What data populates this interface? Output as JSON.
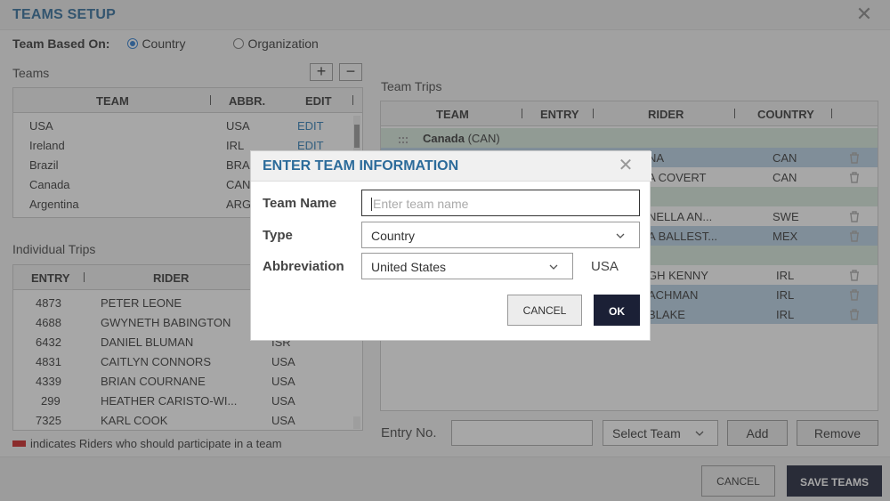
{
  "window": {
    "title": "TEAMS SETUP",
    "close_icon": "close-icon"
  },
  "based_on": {
    "label": "Team Based On:",
    "options": [
      "Country",
      "Organization"
    ],
    "selected": "Country"
  },
  "teams": {
    "label": "Teams",
    "add_icon": "plus-icon",
    "remove_icon": "minus-icon",
    "columns": [
      "TEAM",
      "ABBR.",
      "EDIT"
    ],
    "rows": [
      {
        "team": "USA",
        "abbr": "USA",
        "edit": "EDIT"
      },
      {
        "team": "Ireland",
        "abbr": "IRL",
        "edit": "EDIT"
      },
      {
        "team": "Brazil",
        "abbr": "BRA",
        "edit": ""
      },
      {
        "team": "Canada",
        "abbr": "CAN",
        "edit": ""
      },
      {
        "team": "Argentina",
        "abbr": "ARG",
        "edit": ""
      }
    ]
  },
  "individual": {
    "label": "Individual Trips",
    "columns": [
      "ENTRY",
      "RIDER"
    ],
    "rows": [
      {
        "entry": "4873",
        "rider": "PETER LEONE",
        "country": ""
      },
      {
        "entry": "4688",
        "rider": "GWYNETH BABINGTON",
        "country": ""
      },
      {
        "entry": "6432",
        "rider": "DANIEL BLUMAN",
        "country": "ISR"
      },
      {
        "entry": "4831",
        "rider": "CAITLYN CONNORS",
        "country": "USA"
      },
      {
        "entry": "4339",
        "rider": "BRIAN COURNANE",
        "country": "USA"
      },
      {
        "entry": "299",
        "rider": "HEATHER CARISTO-WI...",
        "country": "USA"
      },
      {
        "entry": "7325",
        "rider": "KARL COOK",
        "country": "USA"
      }
    ],
    "legend": "indicates Riders who should participate in a team",
    "legend_color": "#cc1f1f"
  },
  "team_trips": {
    "label": "Team Trips",
    "columns": [
      "TEAM",
      "ENTRY",
      "RIDER",
      "COUNTRY"
    ],
    "rows": [
      {
        "kind": "group",
        "team": "Canada",
        "abbr": "(CAN)",
        "rider": "",
        "country": ""
      },
      {
        "kind": "sel",
        "team": "",
        "abbr": "",
        "rider": "NA",
        "country": "CAN"
      },
      {
        "kind": "plain",
        "team": "",
        "abbr": "",
        "rider": "A COVERT",
        "country": "CAN"
      },
      {
        "kind": "group",
        "team": "",
        "abbr": "",
        "rider": "",
        "country": ""
      },
      {
        "kind": "plain",
        "team": "",
        "abbr": "",
        "rider": "NELLA AN...",
        "country": "SWE"
      },
      {
        "kind": "sel",
        "team": "",
        "abbr": "",
        "rider": "A BALLEST...",
        "country": "MEX"
      },
      {
        "kind": "group",
        "team": "",
        "abbr": "",
        "rider": "",
        "country": ""
      },
      {
        "kind": "plain",
        "team": "",
        "abbr": "",
        "rider": "GH KENNY",
        "country": "IRL"
      },
      {
        "kind": "sel",
        "team": "",
        "abbr": "",
        "rider": "ACHMAN",
        "country": "IRL"
      },
      {
        "kind": "sel",
        "team": "",
        "abbr": "",
        "rider": "BLAKE",
        "country": "IRL"
      }
    ],
    "group_color": "#d7e9dc",
    "selected_color": "#b8d1e6"
  },
  "entry_bar": {
    "entry_label": "Entry No.",
    "entry_value": "",
    "select_team": "Select Team",
    "add": "Add",
    "remove": "Remove"
  },
  "footer": {
    "cancel": "CANCEL",
    "save": "SAVE TEAMS"
  },
  "dialog": {
    "title": "ENTER TEAM INFORMATION",
    "team_name_label": "Team Name",
    "team_name_placeholder": "Enter team name",
    "team_name_value": "",
    "type_label": "Type",
    "type_value": "Country",
    "abbreviation_label": "Abbreviation",
    "abbreviation_select": "United States",
    "abbreviation_value": "USA",
    "cancel": "CANCEL",
    "ok": "OK"
  },
  "colors": {
    "accent": "#2c6b9a",
    "dark_button": "#1b2036",
    "link": "#2b7bb7"
  }
}
